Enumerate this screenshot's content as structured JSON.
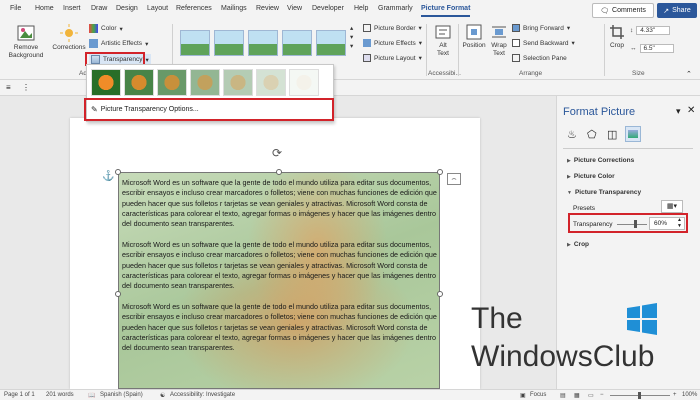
{
  "tabs": [
    "File",
    "Home",
    "Insert",
    "Draw",
    "Design",
    "Layout",
    "References",
    "Mailings",
    "Review",
    "View",
    "Developer",
    "Help",
    "Grammarly",
    "Picture Format"
  ],
  "active_tab": "Picture Format",
  "comments_label": "Comments",
  "share_label": "Share",
  "ribbon": {
    "remove_background": "Remove Background",
    "corrections": "Corrections",
    "color": "Color",
    "artistic_effects": "Artistic Effects",
    "transparency": "Transparency",
    "adjust_group": "Ad",
    "picture_border": "Picture Border",
    "picture_effects": "Picture Effects",
    "picture_layout": "Picture Layout",
    "alt_text": "Alt Text",
    "accessibility_group": "Accessibi...",
    "position": "Position",
    "wrap_text": "Wrap Text",
    "bring_forward": "Bring Forward",
    "send_backward": "Send Backward",
    "selection_pane": "Selection Pane",
    "arrange_group": "Arrange",
    "crop": "Crop",
    "height_value": "4.33\"",
    "width_value": "6.5\"",
    "size_group": "Size"
  },
  "dropdown": {
    "presets": [
      0,
      0.15,
      0.3,
      0.5,
      0.65,
      0.8,
      0.95
    ],
    "options_label": "Picture Transparency Options..."
  },
  "document": {
    "paragraph": "Microsoft Word es un software que la gente de todo el mundo utiliza para editar sus documentos, escribir ensayos e incluso crear marcadores o folletos; viene con muchas funciones de edición que pueden hacer que sus folletos r tarjetas se vean geniales y atractivas. Microsoft Word consta de características para colorear el texto, agregar formas o imágenes y hacer que las imágenes dentro del documento sean transparentes."
  },
  "pane": {
    "title": "Format Picture",
    "sections": [
      "Picture Corrections",
      "Picture Color",
      "Picture Transparency",
      "Crop"
    ],
    "presets_label": "Presets",
    "transparency_label": "Transparency",
    "transparency_value": "60%",
    "transparency_level": 0.6
  },
  "status": {
    "page": "Page 1 of 1",
    "words": "201 words",
    "language": "Spanish (Spain)",
    "accessibility": "Accessibility: Investigate",
    "focus": "Focus",
    "zoom": "100%"
  },
  "watermark": {
    "line1": "The",
    "line2": "WindowsClub"
  },
  "colors": {
    "accent": "#2b579a",
    "highlight": "#d2232a"
  }
}
